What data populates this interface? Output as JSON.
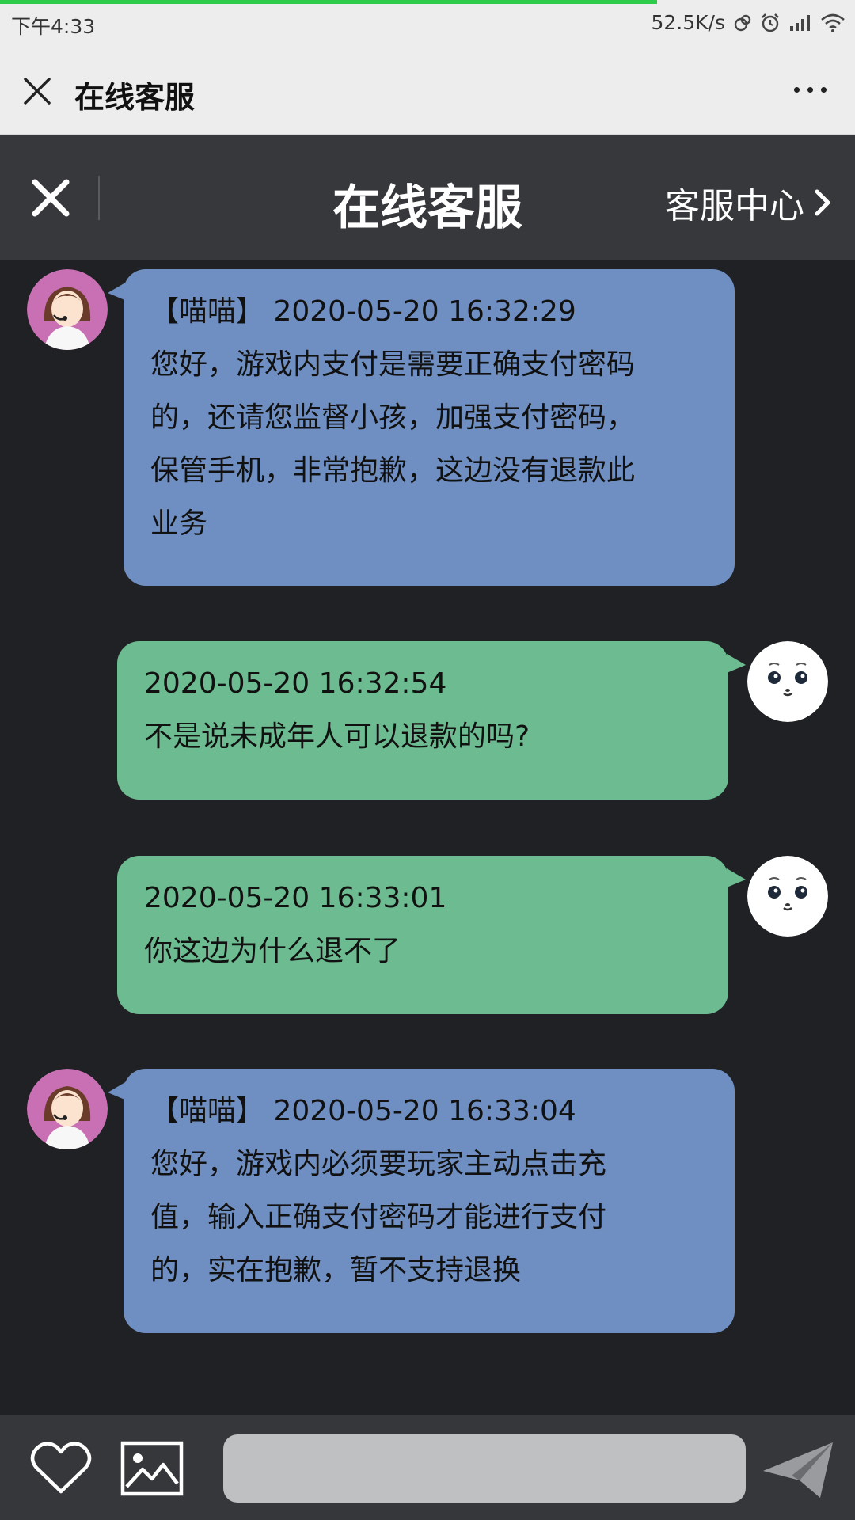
{
  "status_bar": {
    "time": "下午4:33",
    "network_speed": "52.5K/s",
    "icons": [
      "data-sync-icon",
      "alarm-icon",
      "signal-icon",
      "wifi-icon"
    ]
  },
  "wechat_bar": {
    "title": "在线客服",
    "close_icon": "close-icon",
    "more_icon": "more-icon"
  },
  "service_header": {
    "title": "在线客服",
    "service_center_label": "客服中心",
    "close_icon": "close-icon",
    "chevron_icon": "chevron-right-icon"
  },
  "messages": [
    {
      "sender": "agent",
      "lines": [
        "【喵喵】 2020-05-20 16:32:29",
        "您好，游戏内支付是需要正确支付密码",
        "的，还请您监督小孩，加强支付密码，",
        "保管手机，非常抱歉，这边没有退款此",
        "业务"
      ]
    },
    {
      "sender": "user",
      "lines": [
        "2020-05-20 16:32:54",
        "不是说未成年人可以退款的吗?"
      ]
    },
    {
      "sender": "user",
      "lines": [
        "2020-05-20 16:33:01",
        "你这边为什么退不了"
      ]
    },
    {
      "sender": "agent",
      "lines": [
        "【喵喵】 2020-05-20 16:33:04",
        "您好，游戏内必须要玩家主动点击充",
        "值，输入正确支付密码才能进行支付",
        "的，实在抱歉，暂不支持退换"
      ]
    }
  ],
  "input_bar": {
    "message_placeholder": "",
    "icons": [
      "heart-icon",
      "image-icon",
      "send-icon"
    ]
  },
  "colors": {
    "agent_bubble": "#6f8fc2",
    "user_bubble": "#6dbb90",
    "chat_background": "#202124",
    "header_background": "#37383b"
  }
}
